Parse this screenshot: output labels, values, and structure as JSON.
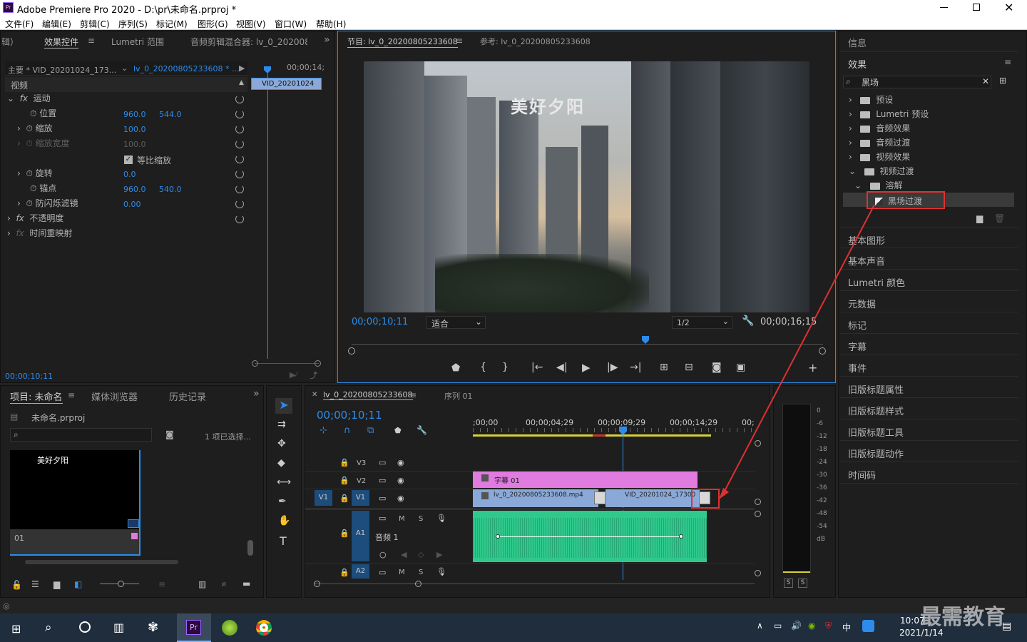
{
  "window": {
    "title": "Adobe Premiere Pro 2020 - D:\\pr\\未命名.prproj *",
    "app_icon": "Pr"
  },
  "menu": [
    "文件(F)",
    "编辑(E)",
    "剪辑(C)",
    "序列(S)",
    "标记(M)",
    "图形(G)",
    "视图(V)",
    "窗口(W)",
    "帮助(H)"
  ],
  "effect_controls": {
    "tabs": [
      "辑）",
      "效果控件",
      "Lumetri 范围",
      "音频剪辑混合器: lv_0_202008"
    ],
    "master_clip": "主要 * VID_20201024_173...",
    "sequence_clip": "lv_0_20200805233608 * ...",
    "mini_timecode": "00;00;14;",
    "mini_clip": "VID_20201024",
    "section_video": "视频",
    "motion": "运动",
    "position_label": "位置",
    "position_x": "960.0",
    "position_y": "544.0",
    "scale_label": "缩放",
    "scale_value": "100.0",
    "scale_width_label": "缩放宽度",
    "scale_width_value": "100.0",
    "uniform_scale_label": "等比缩放",
    "rotation_label": "旋转",
    "rotation_value": "0.0",
    "anchor_label": "锚点",
    "anchor_x": "960.0",
    "anchor_y": "540.0",
    "flicker_label": "防闪烁滤镜",
    "flicker_value": "0.00",
    "opacity": "不透明度",
    "time_remap": "时间重映射",
    "timecode": "00;00;10;11"
  },
  "program_monitor": {
    "tab_program": "节目: lv_0_20200805233608",
    "tab_reference": "参考: lv_0_20200805233608",
    "overlay_title": "美好夕阳",
    "timecode": "00;00;10;11",
    "fit": "适合",
    "resolution": "1/2",
    "duration": "00;00;16;15"
  },
  "effects_panel": {
    "info": "信息",
    "title": "效果",
    "search_value": "黑场",
    "tree": [
      "预设",
      "Lumetri 预设",
      "音频效果",
      "音频过渡",
      "视频效果",
      "视频过渡",
      "溶解",
      "黑场过渡"
    ],
    "side_items": [
      "基本图形",
      "基本声音",
      "Lumetri 颜色",
      "元数据",
      "标记",
      "字幕",
      "事件",
      "旧版标题属性",
      "旧版标题样式",
      "旧版标题工具",
      "旧版标题动作",
      "时间码"
    ]
  },
  "project": {
    "tabs": [
      "项目: 未命名",
      "媒体浏览器",
      "历史记录"
    ],
    "file": "未命名.prproj",
    "selection": "1 项已选择...",
    "thumb_title": "美好夕阳",
    "thumb_label": "01"
  },
  "timeline": {
    "tab_sequence": "lv_0_20200805233608",
    "tab_seq01": "序列 01",
    "timecode": "00;00;10;11",
    "ruler": [
      ";00;00",
      "00;00;04;29",
      "00;00;09;29",
      "00;00;14;29",
      "00;"
    ],
    "tracks": [
      "V3",
      "V2",
      "V1",
      "A1",
      "A2"
    ],
    "v1_source": "V1",
    "title_clip": "字幕 01",
    "clip1": "lv_0_20200805233608.mp4",
    "clip2": "VID_20201024_17300",
    "audio_name": "音频 1",
    "m": "M",
    "s": "S"
  },
  "meter": {
    "ticks": [
      "0",
      "-6",
      "-12",
      "-18",
      "-24",
      "-30",
      "-36",
      "-42",
      "-48",
      "-54",
      "dB"
    ],
    "solo": [
      "S",
      "S"
    ]
  },
  "taskbar": {
    "time": "10:07",
    "date": "2021/1/14",
    "ime": "中",
    "watermark": "最需教育"
  },
  "colors": {
    "accent": "#2d8ceb",
    "title_clip": "#e07be0",
    "video_clip": "#8aa9d8",
    "audio_clip": "#2fc98c",
    "highlight": "#e03030"
  }
}
